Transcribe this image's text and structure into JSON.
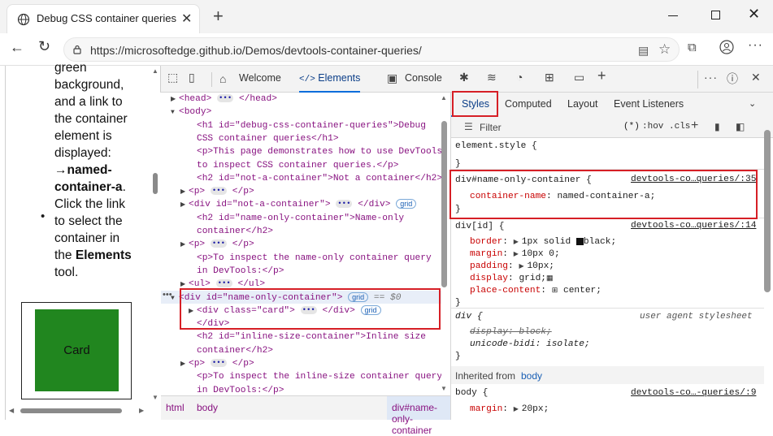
{
  "browser": {
    "tab_title": "Debug CSS container queries",
    "url": "https://microsoftedge.github.io/Demos/devtools-container-queries/"
  },
  "page": {
    "text_lines": [
      "green",
      "background,",
      "and a link to",
      "the container",
      "element is",
      "displayed:"
    ],
    "arrow_line": "→named-",
    "container_line_bold": "container-a",
    "container_line_end": ".",
    "bullet": "•",
    "bullet_lines": [
      "Click the link",
      "to select the",
      "container in",
      "the"
    ],
    "elements_word": "Elements",
    "tool_word": "tool.",
    "card_label": "Card"
  },
  "devtools": {
    "tabs": {
      "welcome": "Welcome",
      "elements": "Elements",
      "console": "Console"
    },
    "dom": [
      {
        "pre": "<head>",
        "dots": true,
        "post": "</head>"
      },
      {
        "pre": "<body>"
      },
      {
        "pre": "<h1 id=\"debug-css-container-queries\">Debug"
      },
      {
        "pre": "CSS container queries</h1>"
      },
      {
        "pre": "<p>This page demonstrates how to use DevTools"
      },
      {
        "pre": "to inspect CSS container queries.</p>"
      },
      {
        "pre": "<h2 id=\"not-a-container\">Not a container</h2>"
      },
      {
        "pre": "<p>",
        "dots": true,
        "post": "</p>"
      },
      {
        "pre": "<div id=\"not-a-container\">",
        "dots": true,
        "post": "</div>",
        "badge": "grid"
      },
      {
        "pre": "<h2 id=\"name-only-container\">Name-only"
      },
      {
        "pre": "container</h2>"
      },
      {
        "pre": "<p>",
        "dots": true,
        "post": "</p>"
      },
      {
        "pre": "<p>To inspect the name-only container query"
      },
      {
        "pre": "in DevTools:</p>"
      },
      {
        "pre": "<ul>",
        "dots": true,
        "post": "</ul>"
      },
      {
        "pre": "<div id=\"name-only-container\">",
        "badge": "grid",
        "tail": "== $0"
      },
      {
        "pre": "<div class=\"card\">",
        "dots": true,
        "post": "</div>",
        "badge": "grid"
      },
      {
        "pre": "</div>"
      },
      {
        "pre": "<h2 id=\"inline-size-container\">Inline size"
      },
      {
        "pre": "container</h2>"
      },
      {
        "pre": "<p>",
        "dots": true,
        "post": "</p>"
      },
      {
        "pre": "<p>To inspect the inline-size container query"
      },
      {
        "pre": "in DevTools:</p>"
      }
    ],
    "breadcrumbs": [
      "html",
      "body",
      "div#name-only-container"
    ],
    "styles_tabs": {
      "styles": "Styles",
      "computed": "Computed",
      "layout": "Layout",
      "events": "Event Listeners"
    },
    "filter_label": "Filter",
    "filter_tools": ":hov  .cls",
    "rules": {
      "element_style": "element.style {",
      "element_style_close": "}",
      "r1_selector": "div#name-only-container {",
      "r1_link": "devtools-co…queries/:35",
      "r1_prop": "container-name",
      "r1_val": "named-container-a;",
      "r1_close": "}",
      "r2_selector": "div[id] {",
      "r2_link": "devtools-co…queries/:14",
      "r2_props": [
        {
          "name": "border",
          "val": "1px solid",
          "val2": "black;"
        },
        {
          "name": "margin",
          "val": "10px 0;"
        },
        {
          "name": "padding",
          "val": "10px;"
        },
        {
          "name": "display",
          "val": "grid;"
        },
        {
          "name": "place-content",
          "val": "center;"
        }
      ],
      "r2_close": "}",
      "ua_selector": "div {",
      "ua_source": "user agent stylesheet",
      "ua_p1": "display: block;",
      "ua_p2": "unicode-bidi: isolate;",
      "ua_close": "}",
      "inherited_label": "Inherited from",
      "inherited_from": "body",
      "body_selector": "body {",
      "body_link": "devtools-co…-queries/:9",
      "body_prop": "margin",
      "body_val": "20px;"
    }
  },
  "colors": {
    "accent": "#0b6ddb",
    "highlight": "#d61f26",
    "card": "#21861f"
  }
}
